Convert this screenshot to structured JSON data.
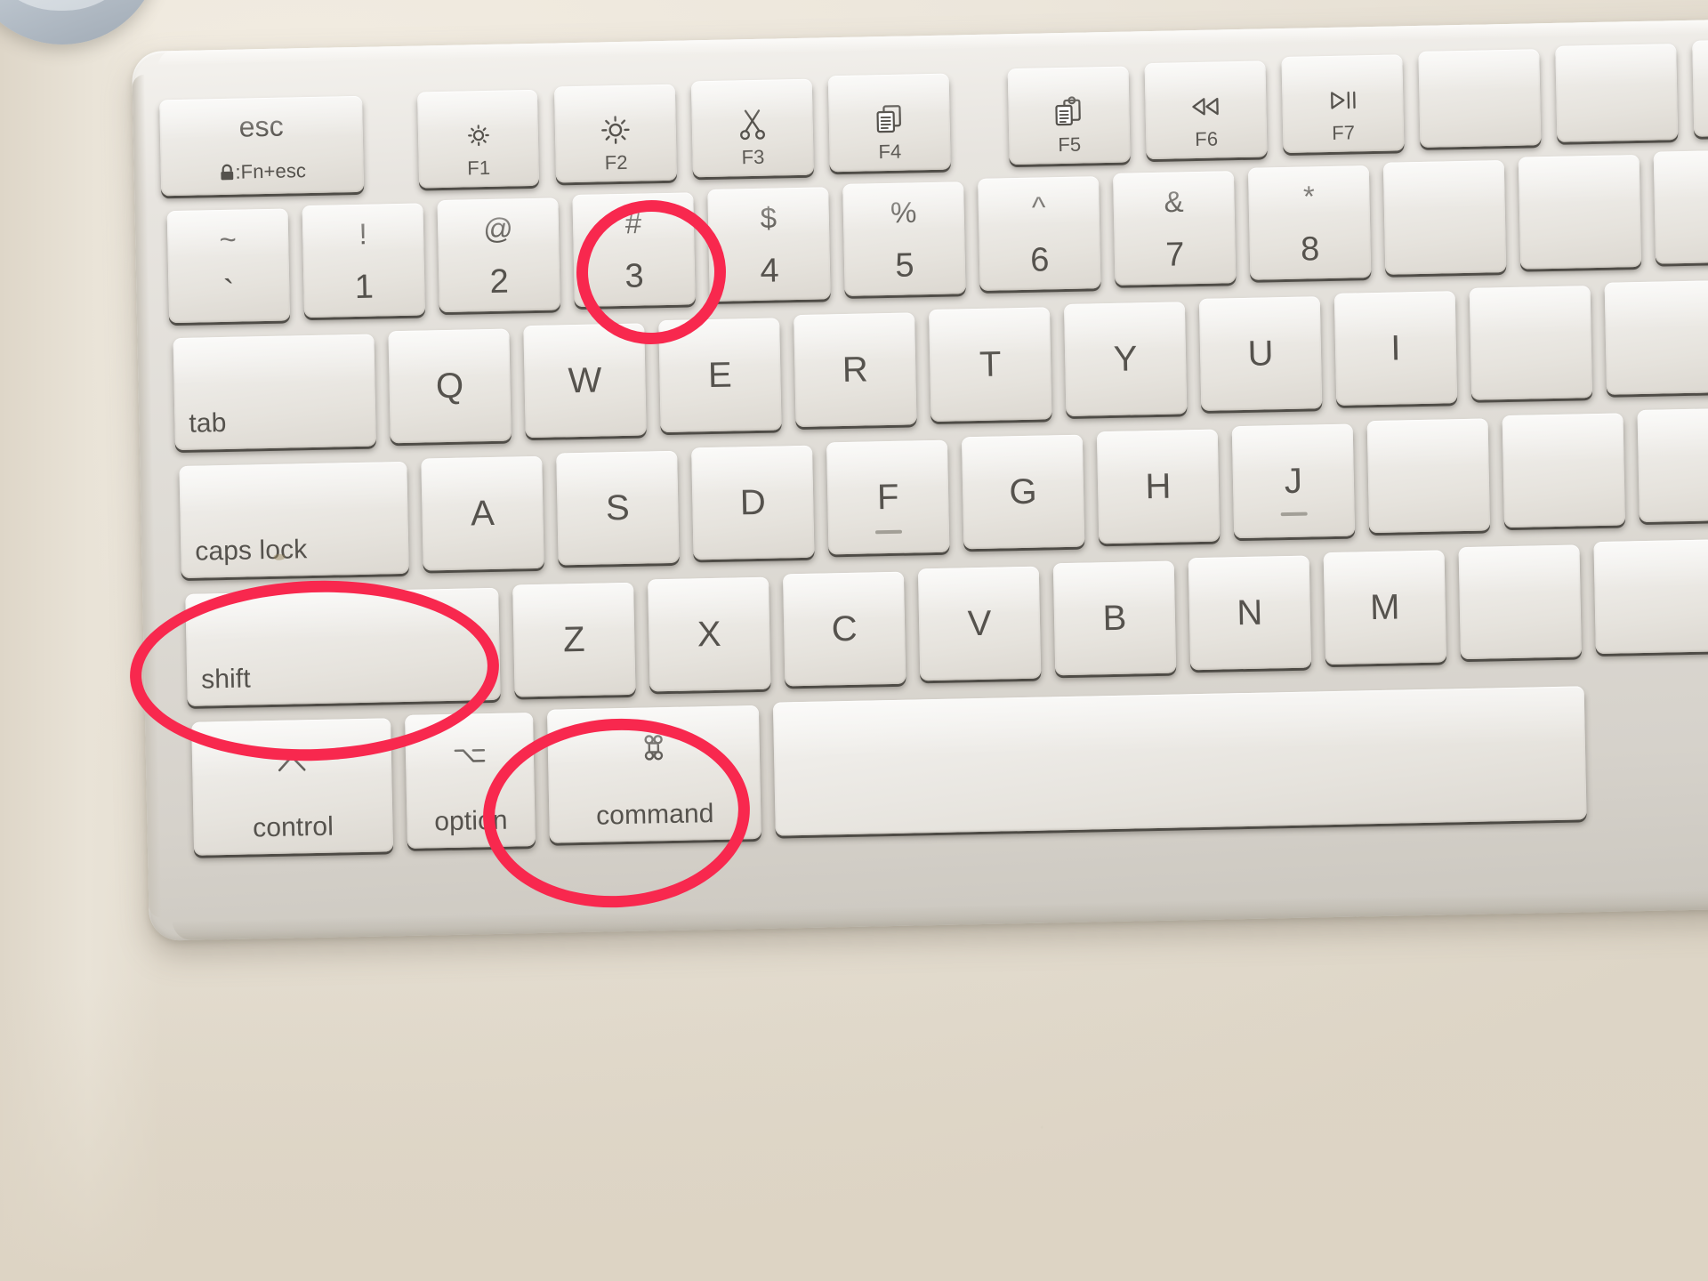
{
  "scene": {
    "subject": "apple-magic-keyboard-photo",
    "surface_color": "#e9e4da",
    "keyboard_body_color": "#e2ded8",
    "key_face_color": "#efedE9",
    "legend_color": "#55524d",
    "annotation_color": "#f8284e"
  },
  "annotations": [
    {
      "id": "ann-3",
      "target_key": "3",
      "shape": "ellipse"
    },
    {
      "id": "ann-shift",
      "target_key": "shift",
      "shape": "ellipse"
    },
    {
      "id": "ann-command",
      "target_key": "command",
      "shape": "ellipse"
    }
  ],
  "rows": {
    "function_row": [
      {
        "name": "esc",
        "top": "esc",
        "sub": ":Fn+esc",
        "icon": "lock-icon",
        "fn": ""
      },
      {
        "name": "f1",
        "top": "",
        "sub": "",
        "icon": "brightness-down-icon",
        "fn": "F1"
      },
      {
        "name": "f2",
        "top": "",
        "sub": "",
        "icon": "brightness-up-icon",
        "fn": "F2"
      },
      {
        "name": "f3",
        "top": "",
        "sub": "",
        "icon": "scissors-cut-icon",
        "fn": "F3"
      },
      {
        "name": "f4",
        "top": "",
        "sub": "",
        "icon": "copy-documents-icon",
        "fn": "F4"
      },
      {
        "name": "f5",
        "top": "",
        "sub": "",
        "icon": "paste-clipboard-icon",
        "fn": "F5"
      },
      {
        "name": "f6",
        "top": "",
        "sub": "",
        "icon": "rewind-icon",
        "fn": "F6"
      },
      {
        "name": "f7",
        "top": "",
        "sub": "",
        "icon": "play-pause-icon",
        "fn": "F7"
      }
    ],
    "number_row": [
      {
        "name": "backtick",
        "upper": "~",
        "lower": "`"
      },
      {
        "name": "one",
        "upper": "!",
        "lower": "1"
      },
      {
        "name": "two",
        "upper": "@",
        "lower": "2"
      },
      {
        "name": "three",
        "upper": "#",
        "lower": "3"
      },
      {
        "name": "four",
        "upper": "$",
        "lower": "4"
      },
      {
        "name": "five",
        "upper": "%",
        "lower": "5"
      },
      {
        "name": "six",
        "upper": "^",
        "lower": "6"
      },
      {
        "name": "seven",
        "upper": "&",
        "lower": "7"
      },
      {
        "name": "eight",
        "upper": "*",
        "lower": "8"
      }
    ],
    "qwerty_row": {
      "tab_label": "tab",
      "letters": [
        "Q",
        "W",
        "E",
        "R",
        "T",
        "Y",
        "U",
        "I"
      ]
    },
    "home_row": {
      "caps_label": "caps lock",
      "letters": [
        "A",
        "S",
        "D",
        "F",
        "G",
        "H",
        "J"
      ]
    },
    "zxcv_row": {
      "shift_label": "shift",
      "letters": [
        "Z",
        "X",
        "C",
        "V",
        "B",
        "N",
        "M"
      ]
    },
    "modifier_row": [
      {
        "name": "control",
        "glyph": "^",
        "label": "control",
        "icon": "caret-up-icon"
      },
      {
        "name": "option",
        "glyph": "⌥",
        "label": "option",
        "icon": "option-alt-icon"
      },
      {
        "name": "command",
        "glyph": "⌘",
        "label": "command",
        "icon": "command-icon"
      },
      {
        "name": "space",
        "glyph": "",
        "label": "",
        "icon": ""
      }
    ]
  }
}
